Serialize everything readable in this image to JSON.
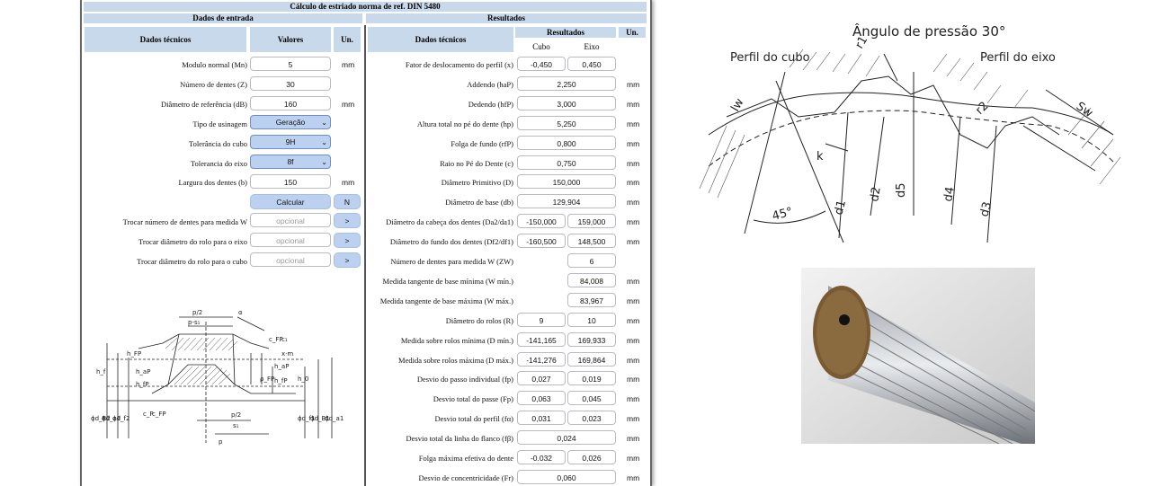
{
  "title": "Cálculo de estriado norma de ref. DIN 5480",
  "input": {
    "section": "Dados de entrada",
    "col_tech": "Dados técnicos",
    "col_values": "Valores",
    "col_unit": "Un.",
    "rows": [
      {
        "label": "Modulo normal (Mn)",
        "value": "5",
        "unit": "mm"
      },
      {
        "label": "Número de dentes (Z)",
        "value": "30",
        "unit": ""
      },
      {
        "label": "Diâmetro de referência (dB)",
        "value": "160",
        "unit": "mm"
      },
      {
        "label": "Tipo de usinagem",
        "value": "Geração",
        "unit": ""
      },
      {
        "label": "Tolerância do cubo",
        "value": "9H",
        "unit": ""
      },
      {
        "label": "Tolerancia do eixo",
        "value": "8f",
        "unit": ""
      },
      {
        "label": "Largura dos dentes (b)",
        "value": "150",
        "unit": "mm"
      }
    ],
    "calc_button": "Calcular",
    "n_button": "N",
    "extra": [
      {
        "label": "Trocar número de dentes para medida W",
        "placeholder": "opcional",
        "button": ">"
      },
      {
        "label": "Trocar diâmetro do rolo para o eixo",
        "placeholder": "opcional",
        "button": ">"
      },
      {
        "label": "Trocar diâmetro do rolo para o cubo",
        "placeholder": "opcional",
        "button": ">"
      }
    ]
  },
  "results": {
    "section": "Resultados",
    "col_tech": "Dados técnicos",
    "col_results": "Resultados",
    "col_unit": "Un.",
    "col_cubo": "Cubo",
    "col_eixo": "Eixo",
    "rows": [
      {
        "label": "Fator de deslocamento do perfil (x)",
        "cubo": "-0,450",
        "eixo": "0,450",
        "unit": ""
      },
      {
        "label": "Addendo (haP)",
        "single": "2,250",
        "unit": "mm"
      },
      {
        "label": "Dedendo (hfP)",
        "single": "3,000",
        "unit": "mm"
      },
      {
        "label": "Altura total no pé do dente (hp)",
        "single": "5,250",
        "unit": "mm"
      },
      {
        "label": "Folga de fundo (rfP)",
        "single": "0,800",
        "unit": "mm"
      },
      {
        "label": "Raio no Pé do Dente (c)",
        "single": "0,750",
        "unit": "mm"
      },
      {
        "label": "Diâmetro Primitivo (D)",
        "single": "150,000",
        "unit": "mm"
      },
      {
        "label": "Diâmetro de base (db)",
        "single": "129,904",
        "unit": "mm"
      },
      {
        "label": "Diâmetro da cabeça dos dentes (Da2/da1)",
        "cubo": "-150,000",
        "eixo": "159,000",
        "unit": "mm"
      },
      {
        "label": "Diâmetro do fundo dos dentes (Df2/df1)",
        "cubo": "-160,500",
        "eixo": "148,500",
        "unit": "mm"
      },
      {
        "label": "Número de dentes para medida W (ZW)",
        "eixo": "6",
        "unit": ""
      },
      {
        "label": "Medida tangente de base mínima (W mín.)",
        "eixo": "84,008",
        "unit": "mm"
      },
      {
        "label": "Medida tangente de base máxima (W máx.)",
        "eixo": "83,967",
        "unit": "mm"
      },
      {
        "label": "Diâmetro do rolos (R)",
        "cubo": "9",
        "eixo": "10",
        "unit": "mm"
      },
      {
        "label": "Medida sobre rolos mínima (D mín.)",
        "cubo": "-141,165",
        "eixo": "169,933",
        "unit": "mm"
      },
      {
        "label": "Medida sobre rolos máxima (D máx.)",
        "cubo": "-141,276",
        "eixo": "169,864",
        "unit": "mm"
      },
      {
        "label": "Desvio do passo individual (fp)",
        "cubo": "0,027",
        "eixo": "0,019",
        "unit": "mm"
      },
      {
        "label": "Desvio total do passe (Fp)",
        "cubo": "0,063",
        "eixo": "0,045",
        "unit": "mm"
      },
      {
        "label": "Desvio total do perfil (fα)",
        "cubo": "0,031",
        "eixo": "0,023",
        "unit": "mm"
      },
      {
        "label": "Desvio total da linha do flanco (fβ)",
        "single": "0,024",
        "unit": "mm"
      },
      {
        "label": "Folga máxima efetiva do dente",
        "cubo": "-0.032",
        "eixo": "0,026",
        "unit": "mm"
      },
      {
        "label": "Desvio de concentricidade (Fr)",
        "single": "0,060",
        "unit": "mm"
      }
    ]
  },
  "diagram_left": {
    "labels": [
      "p/2",
      "p-s1",
      "α",
      "cFP",
      "c1",
      "x·m",
      "hFP",
      "hf",
      "haP",
      "hfP",
      "haP",
      "hP",
      "ρFP",
      "hfP",
      "h0",
      "ϕdB2",
      "ϕda2",
      "ϕdf2",
      "cP",
      "cFP",
      "ϕdf1",
      "ϕdB1",
      "ϕda1",
      "p/2",
      "s1",
      "p"
    ]
  },
  "diagram_right": {
    "title": "Ângulo de pressão 30°",
    "cubo": "Perfil do cubo",
    "eixo": "Perfil do eixo",
    "labels": [
      "r1",
      "lw",
      "k",
      "45°",
      "d1",
      "d2",
      "d5",
      "d4",
      "d3",
      "r2",
      "Sw"
    ]
  }
}
